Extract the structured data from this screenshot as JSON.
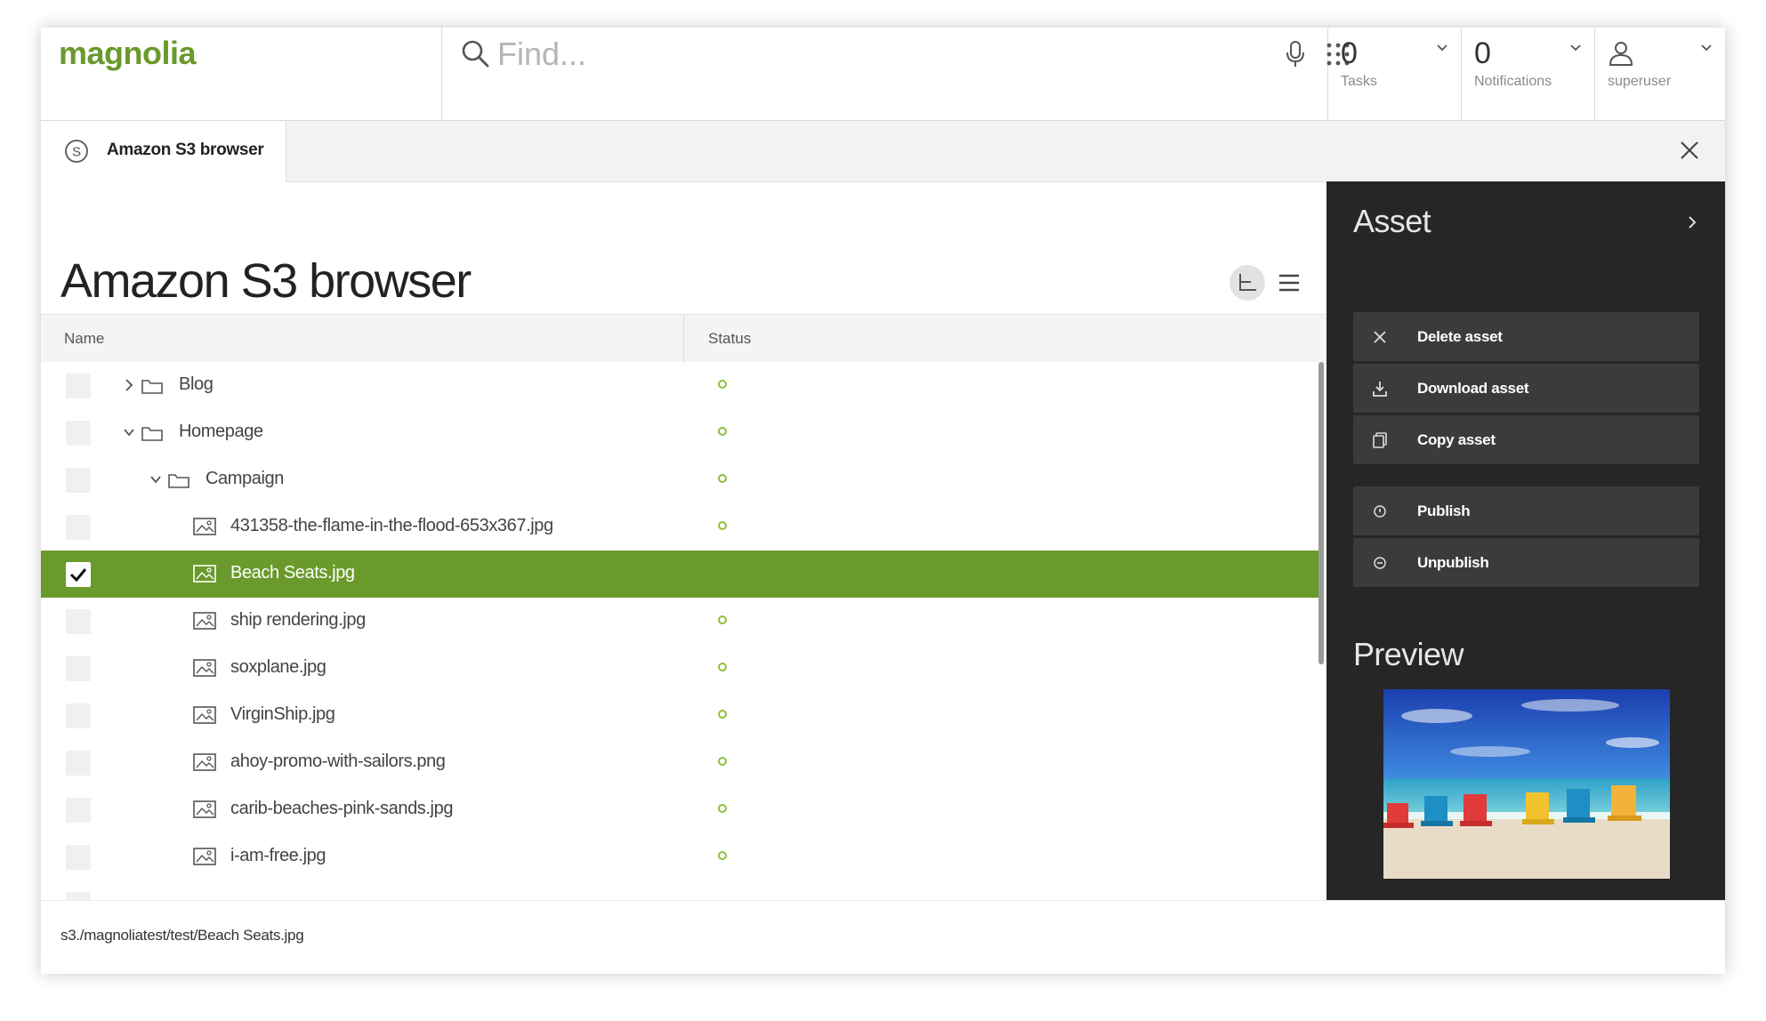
{
  "header": {
    "logo_text": "magnolia",
    "search_placeholder": "Find...",
    "tasks": {
      "count": "0",
      "label": "Tasks"
    },
    "notifications": {
      "count": "0",
      "label": "Notifications"
    },
    "user": {
      "label": "superuser"
    }
  },
  "tab": {
    "label": "Amazon S3 browser"
  },
  "main": {
    "title": "Amazon S3 browser"
  },
  "grid": {
    "columns": {
      "name": "Name",
      "status": "Status"
    },
    "rows": [
      {
        "label": "Blog",
        "type": "folder",
        "expanded": false,
        "selected": false,
        "status": "published"
      },
      {
        "label": "Homepage",
        "type": "folder",
        "expanded": true,
        "selected": false,
        "status": "published"
      },
      {
        "label": "Campaign",
        "type": "folder",
        "expanded": true,
        "selected": false,
        "status": "published"
      },
      {
        "label": "431358-the-flame-in-the-flood-653x367.jpg",
        "type": "image",
        "selected": false,
        "status": "published"
      },
      {
        "label": "Beach Seats.jpg",
        "type": "image",
        "selected": true,
        "status": ""
      },
      {
        "label": "ship rendering.jpg",
        "type": "image",
        "selected": false,
        "status": "published"
      },
      {
        "label": "soxplane.jpg",
        "type": "image",
        "selected": false,
        "status": "published"
      },
      {
        "label": "VirginShip.jpg",
        "type": "image",
        "selected": false,
        "status": "published"
      },
      {
        "label": "ahoy-promo-with-sailors.png",
        "type": "image",
        "selected": false,
        "status": "published"
      },
      {
        "label": "carib-beaches-pink-sands.jpg",
        "type": "image",
        "selected": false,
        "status": "published"
      },
      {
        "label": "i-am-free.jpg",
        "type": "image",
        "selected": false,
        "status": "published"
      }
    ]
  },
  "panel": {
    "title": "Asset",
    "actions": [
      {
        "label": "Delete asset",
        "icon": "close-icon"
      },
      {
        "label": "Download asset",
        "icon": "download-icon"
      },
      {
        "label": "Copy asset",
        "icon": "copy-icon"
      },
      {
        "label": "Publish",
        "icon": "publish-icon"
      },
      {
        "label": "Unpublish",
        "icon": "unpublish-icon"
      }
    ],
    "preview_title": "Preview"
  },
  "footer": {
    "path": "s3./magnoliatest/test/Beach Seats.jpg"
  },
  "colors": {
    "brand_green": "#6a9a2c",
    "status_green": "#8ebd3c",
    "panel_bg": "#262626",
    "action_bg": "#3b3b3b"
  }
}
